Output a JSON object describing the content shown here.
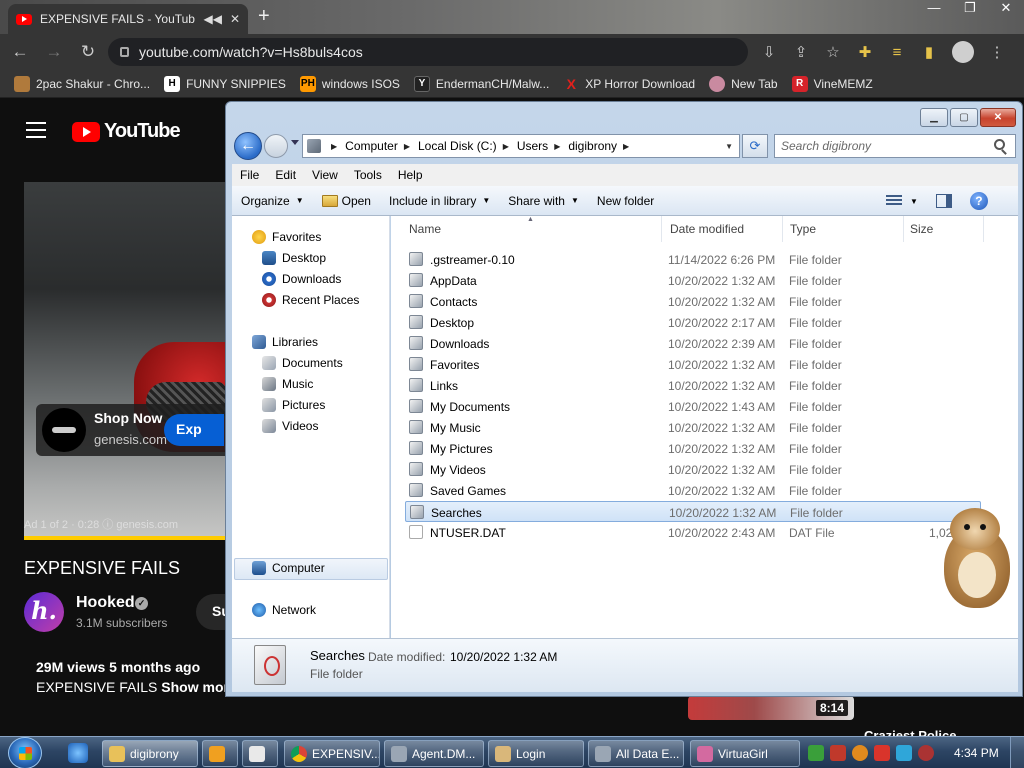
{
  "browser": {
    "tab_title": "EXPENSIVE FAILS - YouTube",
    "url": "youtube.com/watch?v=Hs8buls4cos",
    "bookmarks": [
      {
        "label": "2pac Shakur - Chro...",
        "icon": "bookmark-2pac-icon",
        "color": "#b07a3c"
      },
      {
        "label": "FUNNY SNIPPIES",
        "icon": "bookmark-h-icon",
        "glyph": "H",
        "color": "#ffffff"
      },
      {
        "label": "windows ISOS",
        "icon": "bookmark-ph-icon",
        "glyph": "PH",
        "color": "#ff9900"
      },
      {
        "label": "EndermanCH/Malw...",
        "icon": "bookmark-yp-icon",
        "glyph": "Y",
        "color": "#222222"
      },
      {
        "label": "XP Horror Download",
        "icon": "bookmark-x-icon",
        "glyph": "X",
        "color": "#e0201c"
      },
      {
        "label": "New Tab",
        "icon": "bookmark-globe-icon",
        "color": "#c98aa0"
      },
      {
        "label": "VineMEMZ",
        "icon": "bookmark-r-icon",
        "glyph": "R",
        "color": "#d6232a"
      }
    ]
  },
  "youtube": {
    "logo_text": "YouTube",
    "ad": {
      "title": "Shop Now",
      "domain": "genesis.com",
      "button": "Exp",
      "info": "Ad 1 of 2 · 0:28  ⓘ  genesis.com"
    },
    "video_title": "EXPENSIVE FAILS",
    "channel": {
      "name": "Hooked",
      "avatar_letter": "h.",
      "subscribers": "3.1M subscribers",
      "subscribe_label": "Su"
    },
    "views_line": "29M views  5 months ago",
    "description": "EXPENSIVE FAILS",
    "show_more": "Show more",
    "related": {
      "duration": "8:14",
      "title": "Craziest Police"
    }
  },
  "explorer": {
    "breadcrumb": [
      "Computer",
      "Local Disk (C:)",
      "Users",
      "digibrony"
    ],
    "search_placeholder": "Search digibrony",
    "menu": [
      "File",
      "Edit",
      "View",
      "Tools",
      "Help"
    ],
    "commands": {
      "organize": "Organize",
      "open": "Open",
      "include": "Include in library",
      "share": "Share with",
      "newfolder": "New folder"
    },
    "nav": {
      "favorites": "Favorites",
      "fav_items": [
        "Desktop",
        "Downloads",
        "Recent Places"
      ],
      "libraries": "Libraries",
      "lib_items": [
        "Documents",
        "Music",
        "Pictures",
        "Videos"
      ],
      "computer": "Computer",
      "network": "Network"
    },
    "columns": {
      "name": "Name",
      "date": "Date modified",
      "type": "Type",
      "size": "Size"
    },
    "files": [
      {
        "name": ".gstreamer-0.10",
        "date": "11/14/2022 6:26 PM",
        "type": "File folder",
        "size": ""
      },
      {
        "name": "AppData",
        "date": "10/20/2022 1:32 AM",
        "type": "File folder",
        "size": ""
      },
      {
        "name": "Contacts",
        "date": "10/20/2022 1:32 AM",
        "type": "File folder",
        "size": ""
      },
      {
        "name": "Desktop",
        "date": "10/20/2022 2:17 AM",
        "type": "File folder",
        "size": ""
      },
      {
        "name": "Downloads",
        "date": "10/20/2022 2:39 AM",
        "type": "File folder",
        "size": ""
      },
      {
        "name": "Favorites",
        "date": "10/20/2022 1:32 AM",
        "type": "File folder",
        "size": ""
      },
      {
        "name": "Links",
        "date": "10/20/2022 1:32 AM",
        "type": "File folder",
        "size": ""
      },
      {
        "name": "My Documents",
        "date": "10/20/2022 1:43 AM",
        "type": "File folder",
        "size": ""
      },
      {
        "name": "My Music",
        "date": "10/20/2022 1:32 AM",
        "type": "File folder",
        "size": ""
      },
      {
        "name": "My Pictures",
        "date": "10/20/2022 1:32 AM",
        "type": "File folder",
        "size": ""
      },
      {
        "name": "My Videos",
        "date": "10/20/2022 1:32 AM",
        "type": "File folder",
        "size": ""
      },
      {
        "name": "Saved Games",
        "date": "10/20/2022 1:32 AM",
        "type": "File folder",
        "size": ""
      },
      {
        "name": "Searches",
        "date": "10/20/2022 1:32 AM",
        "type": "File folder",
        "size": "",
        "selected": true
      },
      {
        "name": "NTUSER.DAT",
        "date": "10/20/2022 2:43 AM",
        "type": "DAT File",
        "size": "1,02"
      }
    ],
    "details": {
      "name": "Searches",
      "modified_label": "Date modified:",
      "modified": "10/20/2022 1:32 AM",
      "type": "File folder"
    }
  },
  "taskbar": {
    "items": [
      {
        "label": "digibrony",
        "icon": "explorer-folder-icon",
        "color": "#e8c15a",
        "active": true
      },
      {
        "label": "",
        "icon": "media-player-icon",
        "color": "#f0a020"
      },
      {
        "label": "",
        "icon": "paint-icon",
        "color": "#e9e9e9"
      },
      {
        "label": "EXPENSIV...",
        "icon": "chrome-icon",
        "color": "#3fa24a"
      },
      {
        "label": "Agent.DM...",
        "icon": "app-window-icon",
        "color": "#9aa6b4"
      },
      {
        "label": "Login",
        "icon": "login-app-icon",
        "color": "#d9b77a"
      },
      {
        "label": "All Data E...",
        "icon": "folder-window-icon",
        "color": "#9aa6b4"
      },
      {
        "label": "VirtuaGirl",
        "icon": "virtuagirl-icon",
        "color": "#d36aa0"
      }
    ],
    "clock": "4:34 PM"
  }
}
